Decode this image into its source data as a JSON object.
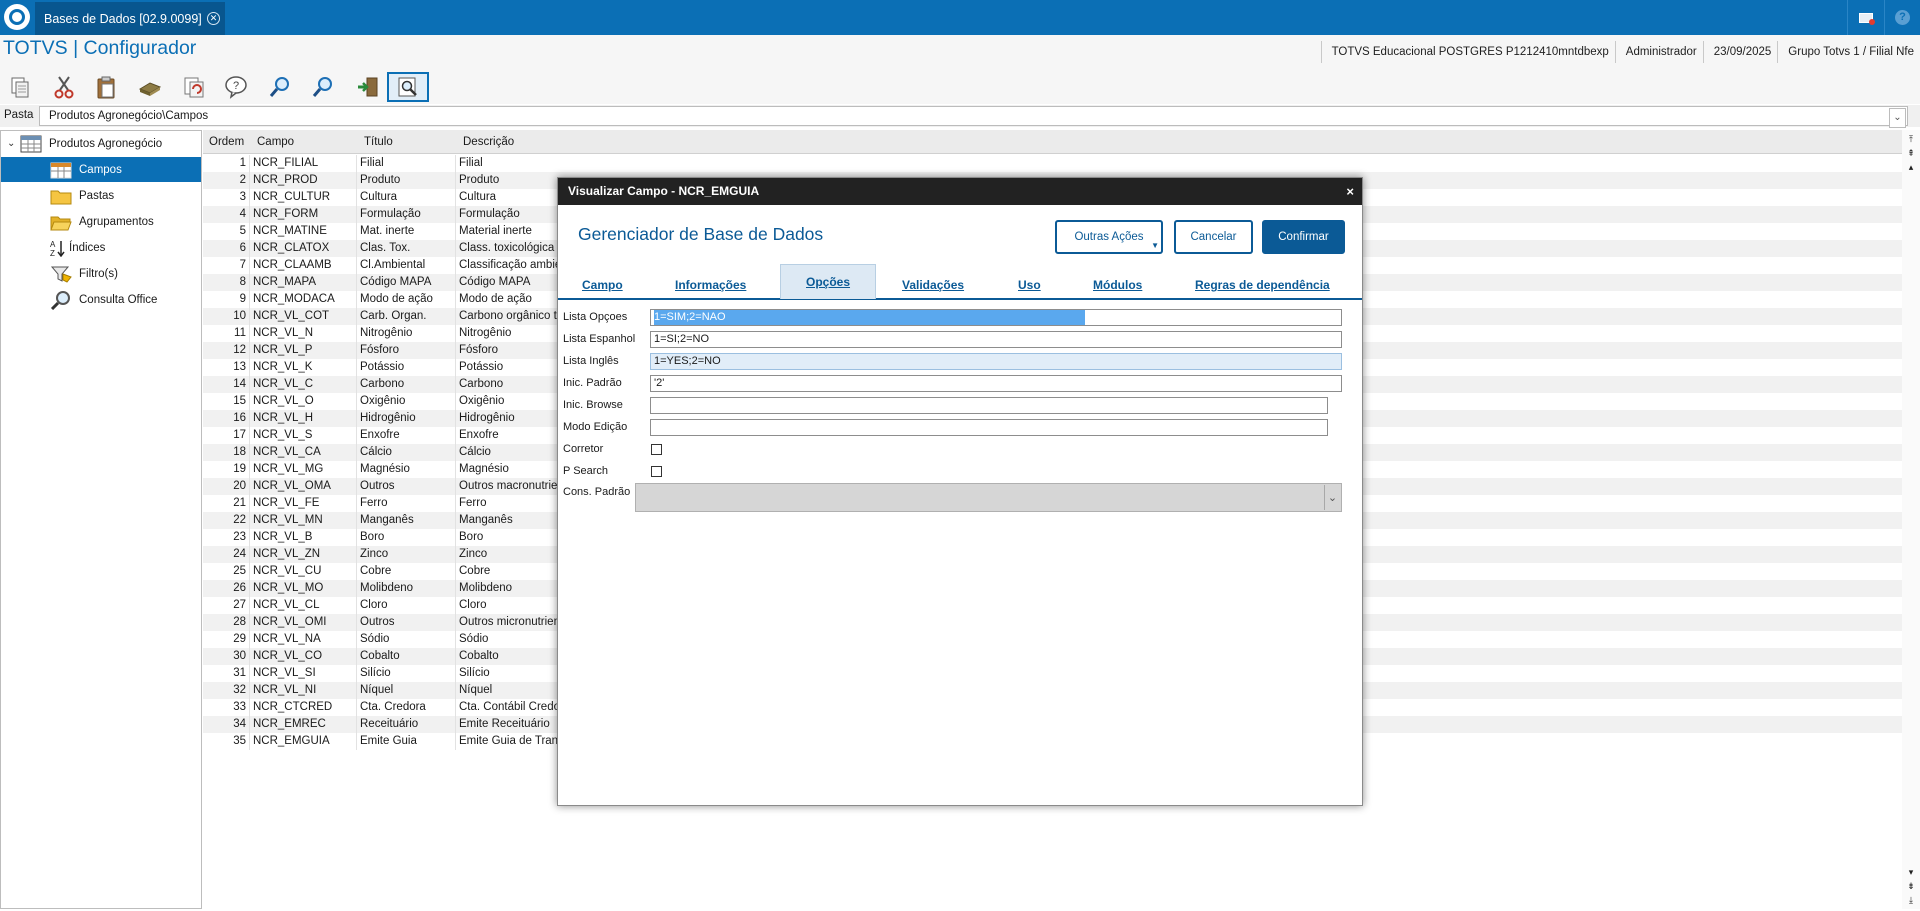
{
  "app": {
    "tab_title": "Bases de Dados [02.9.0099]",
    "title": "TOTVS | Configurador",
    "info": {
      "environment": "TOTVS Educacional POSTGRES P1212410mntdbexp",
      "user": "Administrador",
      "date": "23/09/2025",
      "company": "Grupo Totvs 1 / Filial Nfe"
    }
  },
  "toolbar": {
    "icons": [
      "copy-icon",
      "cut-icon",
      "paste-icon",
      "database-icon",
      "refresh-icon",
      "help-icon",
      "search-icon",
      "search-next-icon",
      "exit-icon",
      "preview-icon"
    ]
  },
  "pasta": {
    "label": "Pasta",
    "value": "Produtos Agronegócio\\Campos"
  },
  "tree": {
    "root": "Produtos Agronegócio",
    "items": [
      {
        "label": "Campos",
        "icon": "grid-icon",
        "selected": true
      },
      {
        "label": "Pastas",
        "icon": "folder-icon",
        "selected": false
      },
      {
        "label": "Agrupamentos",
        "icon": "folder-open-icon",
        "selected": false
      },
      {
        "label": "Índices",
        "icon": "sort-az-icon",
        "selected": false
      },
      {
        "label": "Filtro(s)",
        "icon": "filter-icon",
        "selected": false
      },
      {
        "label": "Consulta Office",
        "icon": "magnifier-icon",
        "selected": false
      }
    ]
  },
  "grid": {
    "headers": [
      "Ordem",
      "Campo",
      "Título",
      "Descrição"
    ],
    "rows": [
      [
        "1",
        "NCR_FILIAL",
        "Filial",
        "Filial"
      ],
      [
        "2",
        "NCR_PROD",
        "Produto",
        "Produto"
      ],
      [
        "3",
        "NCR_CULTUR",
        "Cultura",
        "Cultura"
      ],
      [
        "4",
        "NCR_FORM",
        "Formulação",
        "Formulação"
      ],
      [
        "5",
        "NCR_MATINE",
        "Mat. inerte",
        "Material inerte"
      ],
      [
        "6",
        "NCR_CLATOX",
        "Clas. Tox.",
        "Class. toxicológica"
      ],
      [
        "7",
        "NCR_CLAAMB",
        "Cl.Ambiental",
        "Classificação ambie"
      ],
      [
        "8",
        "NCR_MAPA",
        "Código MAPA",
        "Código MAPA"
      ],
      [
        "9",
        "NCR_MODACA",
        "Modo de ação",
        "Modo de ação"
      ],
      [
        "10",
        "NCR_VL_COT",
        "Carb. Organ.",
        "Carbono orgânico to"
      ],
      [
        "11",
        "NCR_VL_N",
        "Nitrogênio",
        "Nitrogênio"
      ],
      [
        "12",
        "NCR_VL_P",
        "Fósforo",
        "Fósforo"
      ],
      [
        "13",
        "NCR_VL_K",
        "Potássio",
        "Potássio"
      ],
      [
        "14",
        "NCR_VL_C",
        "Carbono",
        "Carbono"
      ],
      [
        "15",
        "NCR_VL_O",
        "Oxigênio",
        "Oxigênio"
      ],
      [
        "16",
        "NCR_VL_H",
        "Hidrogênio",
        "Hidrogênio"
      ],
      [
        "17",
        "NCR_VL_S",
        "Enxofre",
        "Enxofre"
      ],
      [
        "18",
        "NCR_VL_CA",
        "Cálcio",
        "Cálcio"
      ],
      [
        "19",
        "NCR_VL_MG",
        "Magnésio",
        "Magnésio"
      ],
      [
        "20",
        "NCR_VL_OMA",
        "Outros",
        "Outros macronutrien"
      ],
      [
        "21",
        "NCR_VL_FE",
        "Ferro",
        "Ferro"
      ],
      [
        "22",
        "NCR_VL_MN",
        "Manganês",
        "Manganês"
      ],
      [
        "23",
        "NCR_VL_B",
        "Boro",
        "Boro"
      ],
      [
        "24",
        "NCR_VL_ZN",
        "Zinco",
        "Zinco"
      ],
      [
        "25",
        "NCR_VL_CU",
        "Cobre",
        "Cobre"
      ],
      [
        "26",
        "NCR_VL_MO",
        "Molibdeno",
        "Molibdeno"
      ],
      [
        "27",
        "NCR_VL_CL",
        "Cloro",
        "Cloro"
      ],
      [
        "28",
        "NCR_VL_OMI",
        "Outros",
        "Outros micronutrien"
      ],
      [
        "29",
        "NCR_VL_NA",
        "Sódio",
        "Sódio"
      ],
      [
        "30",
        "NCR_VL_CO",
        "Cobalto",
        "Cobalto"
      ],
      [
        "31",
        "NCR_VL_SI",
        "Silício",
        "Silício"
      ],
      [
        "32",
        "NCR_VL_NI",
        "Níquel",
        "Níquel"
      ],
      [
        "33",
        "NCR_CTCRED",
        "Cta. Credora",
        "Cta. Contábil Credo"
      ],
      [
        "34",
        "NCR_EMREC",
        "Receituário",
        "Emite Receituário"
      ],
      [
        "35",
        "NCR_EMGUIA",
        "Emite Guia",
        "Emite Guia de Trans"
      ]
    ]
  },
  "dialog": {
    "title": "Visualizar Campo - NCR_EMGUIA",
    "close_glyph": "×",
    "heading": "Gerenciador de Base de Dados",
    "buttons": {
      "other_actions": "Outras Ações",
      "cancel": "Cancelar",
      "confirm": "Confirmar"
    },
    "tabs": [
      "Campo",
      "Informações",
      "Opções",
      "Validações",
      "Uso",
      "Módulos",
      "Regras de dependência"
    ],
    "active_tab": "Opções",
    "fields": {
      "lista_opcoes": {
        "label": "Lista Opçoes",
        "value": "1=SIM;2=NAO"
      },
      "lista_espanhol": {
        "label": "Lista Espanhol",
        "value": "1=SI;2=NO"
      },
      "lista_ingles": {
        "label": "Lista Inglês",
        "value": "1=YES;2=NO"
      },
      "inic_padrao": {
        "label": "Inic. Padrão",
        "value": "'2'"
      },
      "inic_browse": {
        "label": "Inic. Browse",
        "value": ""
      },
      "modo_edicao": {
        "label": "Modo Edição",
        "value": ""
      },
      "corretor": {
        "label": "Corretor",
        "checked": false
      },
      "p_search": {
        "label": "P Search",
        "checked": false
      },
      "cons_padrao": {
        "label": "Cons. Padrão",
        "value": ""
      }
    }
  },
  "colors": {
    "brand_blue": "#0b6fb5",
    "dialog_blue": "#0b5a96",
    "selection": "#5aa8ee"
  }
}
